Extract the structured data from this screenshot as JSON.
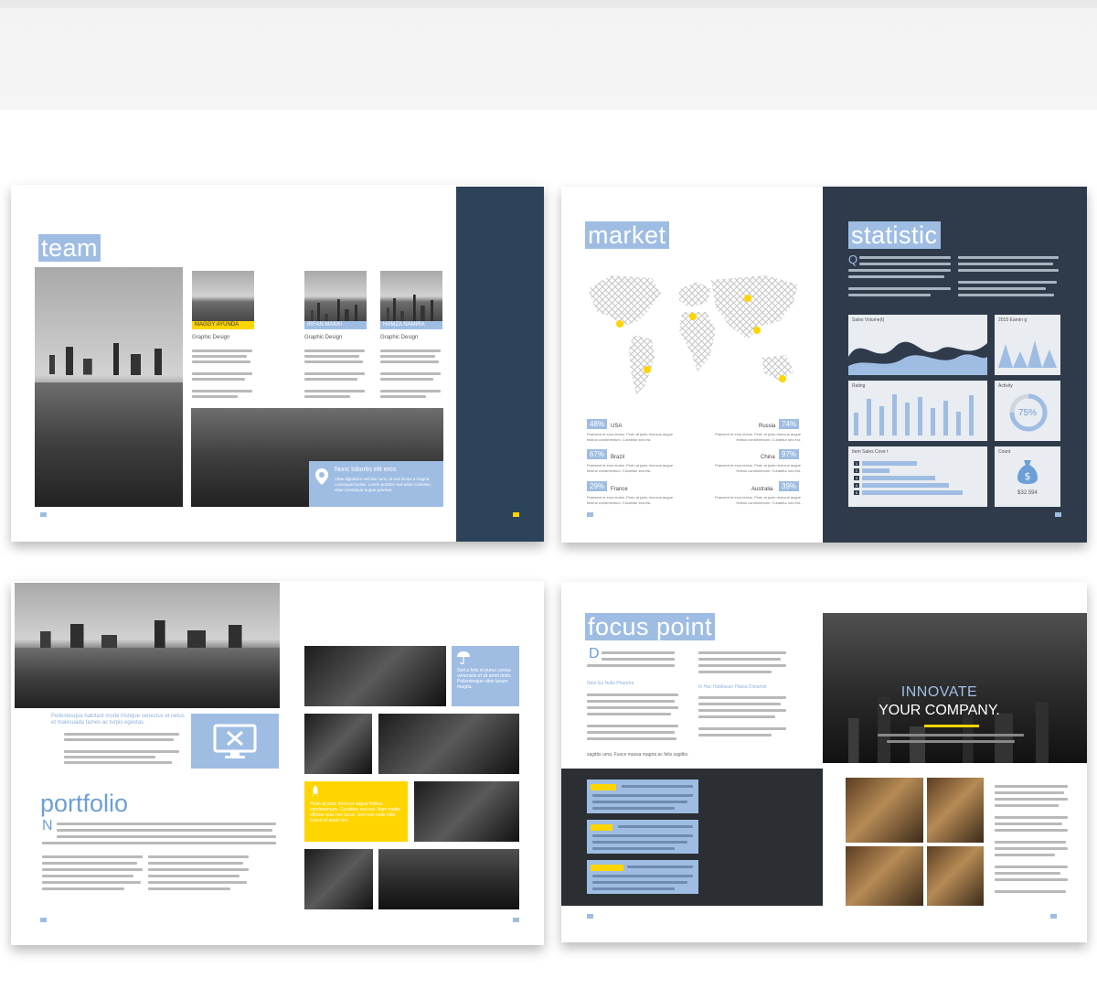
{
  "spreads": {
    "team": {
      "heading": "team",
      "members": [
        {
          "name": "MAGGY AYUNDA",
          "role": "Graphic Design"
        },
        {
          "name": "IRFAN MAKKI",
          "role": "Graphic Design"
        },
        {
          "name": "HAMZA NAMIRA",
          "role": "Graphic Design"
        }
      ],
      "location_title": "Nunc lobortis elit eros",
      "location_text": "Vitae dignissim sed dui nunc, id sed lectus a magna consequat facilisi. Lorem porttitor sed etiam molestie, vitae consequat augue pulvinar."
    },
    "market": {
      "heading": "market",
      "regions": [
        {
          "pct": "48%",
          "country": "USA"
        },
        {
          "pct": "67%",
          "country": "Brazil"
        },
        {
          "pct": "29%",
          "country": "France"
        },
        {
          "pct": "74%",
          "country": "Russia"
        },
        {
          "pct": "97%",
          "country": "China"
        },
        {
          "pct": "39%",
          "country": "Australia"
        }
      ],
      "region_text": "Praesent et eros lectus. Proin at justo rhoncus augue finibus condimentum. Curabitur sed est."
    },
    "statistic": {
      "heading": "statistic",
      "drop_cap": "Q",
      "cards": {
        "sales_volume": "Sales Volume(t)",
        "earnings": "2015 Earnin g",
        "rating": "Rating",
        "activity": "Activity",
        "activity_value": "75%",
        "item_sales": "Item Sales Cove  t",
        "count": "Count",
        "count_value": "$32.594"
      },
      "item_rows": [
        "1",
        "2",
        "3",
        "4",
        "5"
      ]
    },
    "portfolio": {
      "intro": "Pellentesque habitant morbi tristique senectus et netus et malesuada fames ac turpis egestas.",
      "heading": "portfolio",
      "drop_cap": "N",
      "blue_note": "Sed a felis et purus cursus venenatis et sit amet dolor. Pellentesque vitae ipsum magna.",
      "yellow_note": "Proin at justo rhoncus augue finibus condimentum. Curabitur sed est. Nam mattis efficitur quis nec lacus. Sed non nulla nibh. Fusce et amet nec."
    },
    "focus": {
      "heading": "focus point",
      "drop_cap": "D",
      "subhead": "Nam Ea Nulla Pharetra",
      "subhead2": "In Hac Habitasse Platea Dictumst",
      "tagline": "sagittis urna. Fusce massa magna ac felis sagittis.",
      "banner_line1": "INNOVATE",
      "banner_line2": "YOUR COMPANY."
    }
  },
  "colors": {
    "accent_blue": "#9fbde3",
    "navy": "#2c4359",
    "yellow": "#ffd500",
    "dark": "#2b2f33"
  }
}
